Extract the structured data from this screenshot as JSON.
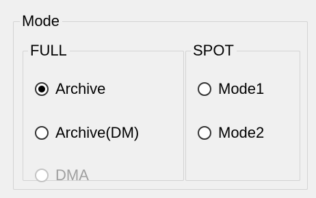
{
  "mode_group": {
    "title": "Mode",
    "full_group": {
      "title": "FULL",
      "options": [
        {
          "label": "Archive",
          "checked": true,
          "enabled": true
        },
        {
          "label": "Archive(DM)",
          "checked": false,
          "enabled": true
        },
        {
          "label": "DMA",
          "checked": false,
          "enabled": false
        }
      ]
    },
    "spot_group": {
      "title": "SPOT",
      "options": [
        {
          "label": "Mode1",
          "checked": false,
          "enabled": true
        },
        {
          "label": "Mode2",
          "checked": false,
          "enabled": true
        }
      ]
    }
  }
}
